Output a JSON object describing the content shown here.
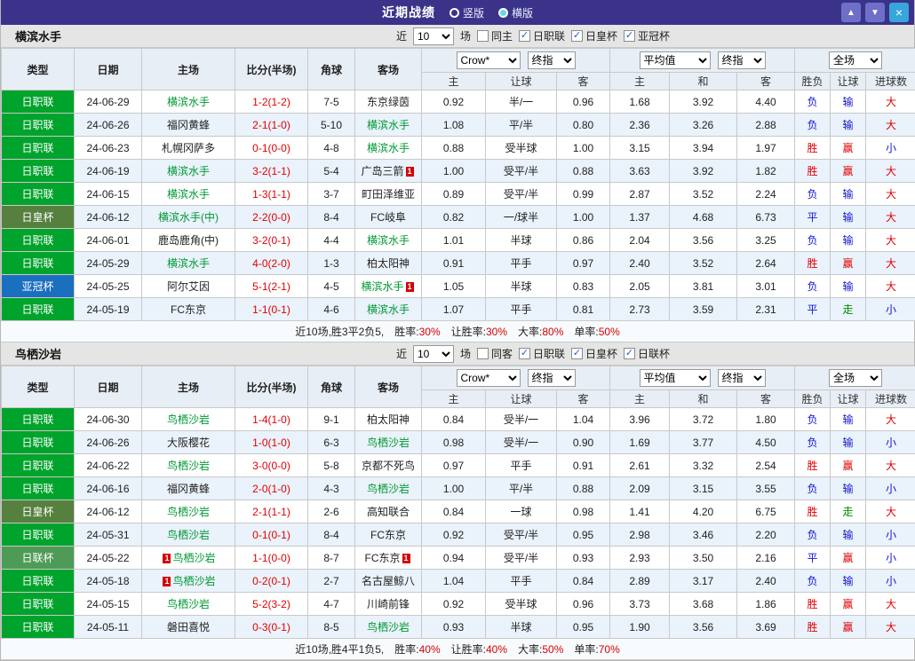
{
  "titlebar": {
    "title": "近期战绩",
    "radios": [
      {
        "label": "竖版",
        "selected": false
      },
      {
        "label": "横版",
        "selected": true
      }
    ],
    "buttons": {
      "up": "▲",
      "down": "▼",
      "close": "×"
    }
  },
  "colors": {
    "league": {
      "日职联": "#00A32C",
      "日皇杯": "#55803E",
      "亚冠杯": "#1B6FBF",
      "日联杯": "#4E9B57"
    },
    "result": {
      "胜": "#E00000",
      "负": "#1414CC",
      "平": "#1414CC",
      "赢": "#E00000",
      "输": "#1414CC",
      "走": "#008A00",
      "大": "#E00000",
      "小": "#1414CC"
    },
    "score": "#E00000",
    "team_highlight": "#009933",
    "badge": "#D40000"
  },
  "table_header": {
    "static_cols": [
      "类型",
      "日期",
      "主场",
      "比分(半场)",
      "角球",
      "客场"
    ],
    "sub_cols": [
      "主",
      "让球",
      "客",
      "主",
      "和",
      "客",
      "胜负",
      "让球",
      "进球数"
    ],
    "selects": {
      "company": "Crow*",
      "final1": "终指",
      "average": "平均值",
      "final2": "终指",
      "scope": "全场"
    }
  },
  "sections": [
    {
      "team": "横滨水手",
      "filter": {
        "near_label": "近",
        "count": "10",
        "games_label": "场",
        "same": {
          "label": "同主",
          "checked": false
        },
        "leagues": [
          {
            "label": "日职联",
            "checked": true
          },
          {
            "label": "日皇杯",
            "checked": true
          },
          {
            "label": "亚冠杯",
            "checked": true
          }
        ]
      },
      "rows": [
        {
          "league": "日职联",
          "date": "24-06-29",
          "home": "横滨水手",
          "home_hl": true,
          "score": "1-2(1-2)",
          "corner": "7-5",
          "away": "东京绿茵",
          "away_hl": false,
          "odds": [
            "0.92",
            "半/一",
            "0.96"
          ],
          "avg": [
            "1.68",
            "3.92",
            "4.40"
          ],
          "results": [
            "负",
            "输",
            "大"
          ]
        },
        {
          "league": "日职联",
          "date": "24-06-26",
          "home": "福冈黄蜂",
          "home_hl": false,
          "score": "2-1(1-0)",
          "corner": "5-10",
          "away": "横滨水手",
          "away_hl": true,
          "odds": [
            "1.08",
            "平/半",
            "0.80"
          ],
          "avg": [
            "2.36",
            "3.26",
            "2.88"
          ],
          "results": [
            "负",
            "输",
            "大"
          ]
        },
        {
          "league": "日职联",
          "date": "24-06-23",
          "home": "札幌冈萨多",
          "home_hl": false,
          "score": "0-1(0-0)",
          "corner": "4-8",
          "away": "横滨水手",
          "away_hl": true,
          "odds": [
            "0.88",
            "受半球",
            "1.00"
          ],
          "avg": [
            "3.15",
            "3.94",
            "1.97"
          ],
          "results": [
            "胜",
            "赢",
            "小"
          ]
        },
        {
          "league": "日职联",
          "date": "24-06-19",
          "home": "横滨水手",
          "home_hl": true,
          "score": "3-2(1-1)",
          "corner": "5-4",
          "away": "广岛三箭",
          "away_hl": false,
          "away_badge": "1",
          "away_badge_side": "right",
          "odds": [
            "1.00",
            "受平/半",
            "0.88"
          ],
          "avg": [
            "3.63",
            "3.92",
            "1.82"
          ],
          "results": [
            "胜",
            "赢",
            "大"
          ]
        },
        {
          "league": "日职联",
          "date": "24-06-15",
          "home": "横滨水手",
          "home_hl": true,
          "score": "1-3(1-1)",
          "corner": "3-7",
          "away": "町田泽维亚",
          "away_hl": false,
          "odds": [
            "0.89",
            "受平/半",
            "0.99"
          ],
          "avg": [
            "2.87",
            "3.52",
            "2.24"
          ],
          "results": [
            "负",
            "输",
            "大"
          ]
        },
        {
          "league": "日皇杯",
          "date": "24-06-12",
          "home": "横滨水手(中)",
          "home_hl": true,
          "score": "2-2(0-0)",
          "corner": "8-4",
          "away": "FC岐阜",
          "away_hl": false,
          "odds": [
            "0.82",
            "一/球半",
            "1.00"
          ],
          "avg": [
            "1.37",
            "4.68",
            "6.73"
          ],
          "results": [
            "平",
            "输",
            "大"
          ]
        },
        {
          "league": "日职联",
          "date": "24-06-01",
          "home": "鹿岛鹿角(中)",
          "home_hl": false,
          "score": "3-2(0-1)",
          "corner": "4-4",
          "away": "横滨水手",
          "away_hl": true,
          "odds": [
            "1.01",
            "半球",
            "0.86"
          ],
          "avg": [
            "2.04",
            "3.56",
            "3.25"
          ],
          "results": [
            "负",
            "输",
            "大"
          ]
        },
        {
          "league": "日职联",
          "date": "24-05-29",
          "home": "横滨水手",
          "home_hl": true,
          "score": "4-0(2-0)",
          "corner": "1-3",
          "away": "柏太阳神",
          "away_hl": false,
          "odds": [
            "0.91",
            "平手",
            "0.97"
          ],
          "avg": [
            "2.40",
            "3.52",
            "2.64"
          ],
          "results": [
            "胜",
            "赢",
            "大"
          ]
        },
        {
          "league": "亚冠杯",
          "date": "24-05-25",
          "home": "阿尔艾因",
          "home_hl": false,
          "score": "5-1(2-1)",
          "corner": "4-5",
          "away": "横滨水手",
          "away_hl": true,
          "away_badge": "1",
          "away_badge_side": "right",
          "odds": [
            "1.05",
            "半球",
            "0.83"
          ],
          "avg": [
            "2.05",
            "3.81",
            "3.01"
          ],
          "results": [
            "负",
            "输",
            "大"
          ]
        },
        {
          "league": "日职联",
          "date": "24-05-19",
          "home": "FC东京",
          "home_hl": false,
          "score": "1-1(0-1)",
          "corner": "4-6",
          "away": "横滨水手",
          "away_hl": true,
          "odds": [
            "1.07",
            "平手",
            "0.81"
          ],
          "avg": [
            "2.73",
            "3.59",
            "2.31"
          ],
          "results": [
            "平",
            "走",
            "小"
          ]
        }
      ],
      "summary": {
        "record": "近10场,胜3平2负5,",
        "stats": [
          {
            "label": "胜率:",
            "value": "30%"
          },
          {
            "label": "让胜率:",
            "value": "30%"
          },
          {
            "label": "大率:",
            "value": "80%"
          },
          {
            "label": "单率:",
            "value": "50%"
          }
        ]
      }
    },
    {
      "team": "鸟栖沙岩",
      "filter": {
        "near_label": "近",
        "count": "10",
        "games_label": "场",
        "same": {
          "label": "同客",
          "checked": false
        },
        "leagues": [
          {
            "label": "日职联",
            "checked": true
          },
          {
            "label": "日皇杯",
            "checked": true
          },
          {
            "label": "日联杯",
            "checked": true
          }
        ]
      },
      "rows": [
        {
          "league": "日职联",
          "date": "24-06-30",
          "home": "鸟栖沙岩",
          "home_hl": true,
          "score": "1-4(1-0)",
          "corner": "9-1",
          "away": "柏太阳神",
          "away_hl": false,
          "odds": [
            "0.84",
            "受半/一",
            "1.04"
          ],
          "avg": [
            "3.96",
            "3.72",
            "1.80"
          ],
          "results": [
            "负",
            "输",
            "大"
          ]
        },
        {
          "league": "日职联",
          "date": "24-06-26",
          "home": "大阪樱花",
          "home_hl": false,
          "score": "1-0(1-0)",
          "corner": "6-3",
          "away": "鸟栖沙岩",
          "away_hl": true,
          "odds": [
            "0.98",
            "受半/一",
            "0.90"
          ],
          "avg": [
            "1.69",
            "3.77",
            "4.50"
          ],
          "results": [
            "负",
            "输",
            "小"
          ]
        },
        {
          "league": "日职联",
          "date": "24-06-22",
          "home": "鸟栖沙岩",
          "home_hl": true,
          "score": "3-0(0-0)",
          "corner": "5-8",
          "away": "京都不死鸟",
          "away_hl": false,
          "odds": [
            "0.97",
            "平手",
            "0.91"
          ],
          "avg": [
            "2.61",
            "3.32",
            "2.54"
          ],
          "results": [
            "胜",
            "赢",
            "大"
          ]
        },
        {
          "league": "日职联",
          "date": "24-06-16",
          "home": "福冈黄蜂",
          "home_hl": false,
          "score": "2-0(1-0)",
          "corner": "4-3",
          "away": "鸟栖沙岩",
          "away_hl": true,
          "odds": [
            "1.00",
            "平/半",
            "0.88"
          ],
          "avg": [
            "2.09",
            "3.15",
            "3.55"
          ],
          "results": [
            "负",
            "输",
            "小"
          ]
        },
        {
          "league": "日皇杯",
          "date": "24-06-12",
          "home": "鸟栖沙岩",
          "home_hl": true,
          "score": "2-1(1-1)",
          "corner": "2-6",
          "away": "高知联合",
          "away_hl": false,
          "odds": [
            "0.84",
            "一球",
            "0.98"
          ],
          "avg": [
            "1.41",
            "4.20",
            "6.75"
          ],
          "results": [
            "胜",
            "走",
            "大"
          ]
        },
        {
          "league": "日职联",
          "date": "24-05-31",
          "home": "鸟栖沙岩",
          "home_hl": true,
          "score": "0-1(0-1)",
          "corner": "8-4",
          "away": "FC东京",
          "away_hl": false,
          "odds": [
            "0.92",
            "受平/半",
            "0.95"
          ],
          "avg": [
            "2.98",
            "3.46",
            "2.20"
          ],
          "results": [
            "负",
            "输",
            "小"
          ]
        },
        {
          "league": "日联杯",
          "date": "24-05-22",
          "home": "鸟栖沙岩",
          "home_hl": true,
          "home_badge": "1",
          "home_badge_side": "left",
          "score": "1-1(0-0)",
          "corner": "8-7",
          "away": "FC东京",
          "away_hl": false,
          "away_badge": "1",
          "away_badge_side": "right",
          "odds": [
            "0.94",
            "受平/半",
            "0.93"
          ],
          "avg": [
            "2.93",
            "3.50",
            "2.16"
          ],
          "results": [
            "平",
            "赢",
            "小"
          ]
        },
        {
          "league": "日职联",
          "date": "24-05-18",
          "home": "鸟栖沙岩",
          "home_hl": true,
          "home_badge": "1",
          "home_badge_side": "left",
          "score": "0-2(0-1)",
          "corner": "2-7",
          "away": "名古屋鲸八",
          "away_hl": false,
          "odds": [
            "1.04",
            "平手",
            "0.84"
          ],
          "avg": [
            "2.89",
            "3.17",
            "2.40"
          ],
          "results": [
            "负",
            "输",
            "小"
          ]
        },
        {
          "league": "日职联",
          "date": "24-05-15",
          "home": "鸟栖沙岩",
          "home_hl": true,
          "score": "5-2(3-2)",
          "corner": "4-7",
          "away": "川崎前锋",
          "away_hl": false,
          "odds": [
            "0.92",
            "受半球",
            "0.96"
          ],
          "avg": [
            "3.73",
            "3.68",
            "1.86"
          ],
          "results": [
            "胜",
            "赢",
            "大"
          ]
        },
        {
          "league": "日职联",
          "date": "24-05-11",
          "home": "磐田喜悦",
          "home_hl": false,
          "score": "0-3(0-1)",
          "corner": "8-5",
          "away": "鸟栖沙岩",
          "away_hl": true,
          "odds": [
            "0.93",
            "半球",
            "0.95"
          ],
          "avg": [
            "1.90",
            "3.56",
            "3.69"
          ],
          "results": [
            "胜",
            "赢",
            "大"
          ]
        }
      ],
      "summary": {
        "record": "近10场,胜4平1负5,",
        "stats": [
          {
            "label": "胜率:",
            "value": "40%"
          },
          {
            "label": "让胜率:",
            "value": "40%"
          },
          {
            "label": "大率:",
            "value": "50%"
          },
          {
            "label": "单率:",
            "value": "70%"
          }
        ]
      }
    }
  ]
}
